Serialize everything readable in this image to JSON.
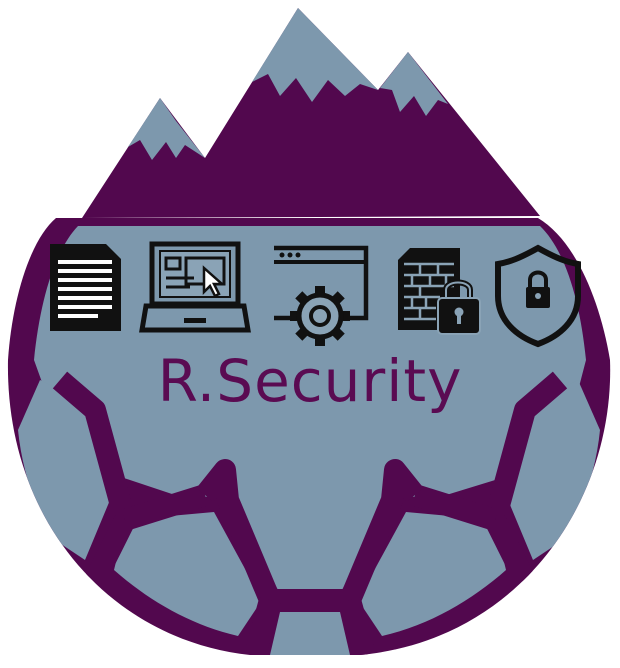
{
  "logo": {
    "name": "R.Security",
    "colors": {
      "primary": "#52084e",
      "fill": "#7d98ad",
      "icon": "#111111",
      "icon_bg": "#ffffff",
      "text": "#5a0b52"
    },
    "icons": [
      "document-icon",
      "laptop-cursor-icon",
      "browser-gear-icon",
      "locked-firewall-document-icon",
      "shield-lock-icon"
    ]
  }
}
